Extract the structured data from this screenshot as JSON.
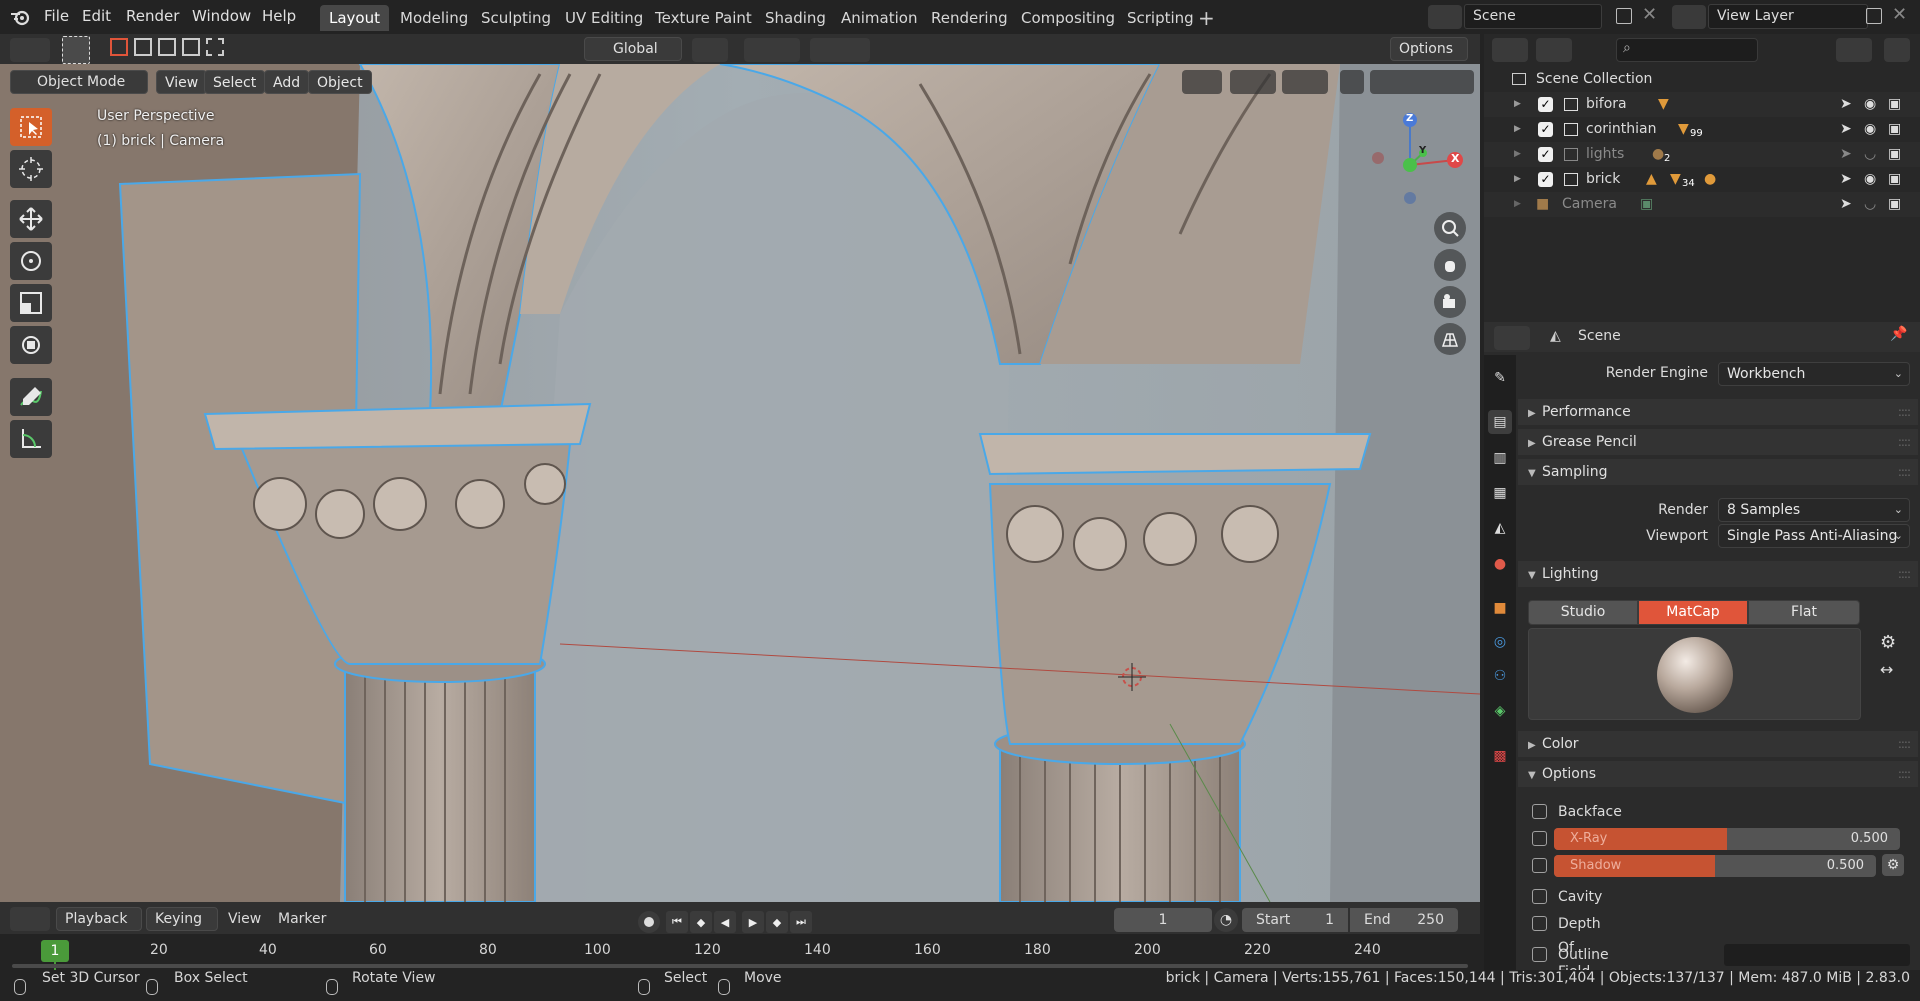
{
  "app": {
    "name": "Blender",
    "logo": "blender-logo-icon"
  },
  "menus": [
    "File",
    "Edit",
    "Render",
    "Window",
    "Help"
  ],
  "workspaces": [
    "Layout",
    "Modeling",
    "Sculpting",
    "UV Editing",
    "Texture Paint",
    "Shading",
    "Animation",
    "Rendering",
    "Compositing",
    "Scripting"
  ],
  "active_workspace": "Layout",
  "scene_name": "Scene",
  "view_layer": "View Layer",
  "viewport": {
    "orientation": "Global",
    "options_label": "Options",
    "mode": "Object Mode",
    "header_menus": [
      "View",
      "Select",
      "Add",
      "Object"
    ],
    "overlay_line1": "User Perspective",
    "overlay_line2": "(1) brick | Camera",
    "gizmo_axes": [
      "X",
      "Y",
      "Z"
    ]
  },
  "toolbar_tools": [
    "select-box",
    "cursor",
    "move",
    "rotate",
    "scale",
    "transform",
    "annotate",
    "measure"
  ],
  "outliner": {
    "root": "Scene Collection",
    "rows": [
      {
        "name": "bifora",
        "checked": true,
        "badge": ""
      },
      {
        "name": "corinthian",
        "checked": true,
        "badge": "99"
      },
      {
        "name": "lights",
        "checked": true,
        "badge": "2"
      },
      {
        "name": "brick",
        "checked": true,
        "badge": "34"
      },
      {
        "name": "Camera",
        "checked": false,
        "badge": ""
      }
    ]
  },
  "properties": {
    "context": "Scene",
    "render_engine_label": "Render Engine",
    "render_engine": "Workbench",
    "panels": {
      "performance": "Performance",
      "grease_pencil": "Grease Pencil",
      "sampling": "Sampling",
      "lighting": "Lighting",
      "color": "Color",
      "options": "Options"
    },
    "sampling": {
      "render_label": "Render",
      "render_value": "8 Samples",
      "viewport_label": "Viewport",
      "viewport_value": "Single Pass Anti-Aliasing"
    },
    "lighting_modes": [
      "Studio",
      "MatCap",
      "Flat"
    ],
    "lighting_active": "MatCap",
    "options": {
      "backface_culling": "Backface Culling",
      "xray_label": "X-Ray",
      "xray_value": "0.500",
      "xray_fraction": 0.5,
      "shadow_label": "Shadow",
      "shadow_value": "0.500",
      "shadow_fraction": 0.5,
      "cavity": "Cavity",
      "depth_of_field": "Depth Of Field",
      "outline": "Outline"
    }
  },
  "timeline": {
    "menus": [
      "Playback",
      "Keying",
      "View",
      "Marker"
    ],
    "current_frame": "1",
    "start_label": "Start",
    "start": "1",
    "end_label": "End",
    "end": "250",
    "ticks": [
      "20",
      "40",
      "60",
      "80",
      "100",
      "120",
      "140",
      "160",
      "180",
      "200",
      "220",
      "240"
    ],
    "playhead_label": "1"
  },
  "status": {
    "hints": [
      "Set 3D Cursor",
      "Box Select",
      "Rotate View",
      "Select",
      "Move"
    ],
    "stats": "brick | Camera | Verts:155,761 | Faces:150,144 | Tris:301,404 | Objects:137/137 | Mem: 487.0 MiB | 2.83.0"
  },
  "colors": {
    "accent": "#e0553a",
    "active_tool": "#d4602a",
    "selection_outline": "#4aa8e8"
  }
}
